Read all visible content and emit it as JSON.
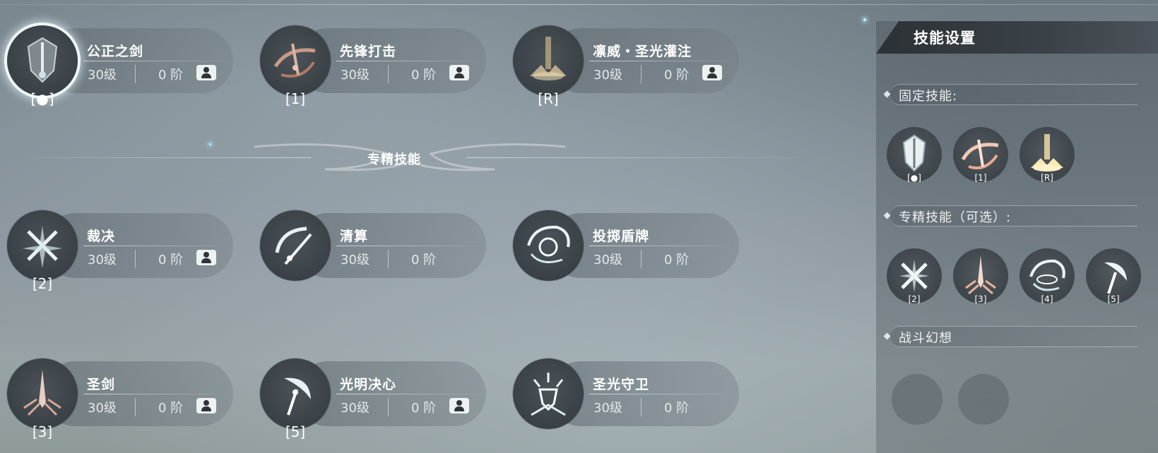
{
  "skills": [
    {
      "id": "s1",
      "name": "公正之剑",
      "level": "30级",
      "rank": "0 阶",
      "key": "[●]",
      "lock": true,
      "selected": true,
      "icon": "shield-sword-icon"
    },
    {
      "id": "s2",
      "name": "先锋打击",
      "level": "30级",
      "rank": "0 阶",
      "key": "[1]",
      "lock": true,
      "selected": false,
      "icon": "slash-strike-icon"
    },
    {
      "id": "s3",
      "name": "凛威・圣光灌注",
      "level": "30级",
      "rank": "0 阶",
      "key": "[R]",
      "lock": true,
      "selected": false,
      "icon": "holy-burst-icon"
    },
    {
      "id": "s4",
      "name": "裁决",
      "level": "30级",
      "rank": "0 阶",
      "key": "[2]",
      "lock": true,
      "selected": false,
      "icon": "cross-blade-icon"
    },
    {
      "id": "s5",
      "name": "清算",
      "level": "30级",
      "rank": "0 阶",
      "key": "",
      "lock": false,
      "selected": false,
      "icon": "arc-sword-icon"
    },
    {
      "id": "s6",
      "name": "投掷盾牌",
      "level": "30级",
      "rank": "0 阶",
      "key": "",
      "lock": false,
      "selected": false,
      "icon": "shield-throw-icon"
    },
    {
      "id": "s7",
      "name": "圣剑",
      "level": "30级",
      "rank": "0 阶",
      "key": "[3]",
      "lock": true,
      "selected": false,
      "icon": "holy-sword-icon"
    },
    {
      "id": "s8",
      "name": "光明决心",
      "level": "30级",
      "rank": "0 阶",
      "key": "[5]",
      "lock": true,
      "selected": false,
      "icon": "light-resolve-icon"
    },
    {
      "id": "s9",
      "name": "圣光守卫",
      "level": "30级",
      "rank": "0 阶",
      "key": "",
      "lock": false,
      "selected": false,
      "icon": "holy-guard-icon"
    }
  ],
  "divider": {
    "title": "专精技能"
  },
  "panel": {
    "title": "技能设置",
    "fixed_label": "固定技能:",
    "fixed_keys": [
      "[●]",
      "[1]",
      "[R]"
    ],
    "spec_label": "专精技能（可选）:",
    "spec_keys": [
      "[2]",
      "[3]",
      "[4]",
      "[5]"
    ],
    "fantasy_label": "战斗幻想"
  },
  "colors": {
    "accent": "#ffffff",
    "glow": "#bff0f6",
    "panel_header": "#2c3135"
  }
}
